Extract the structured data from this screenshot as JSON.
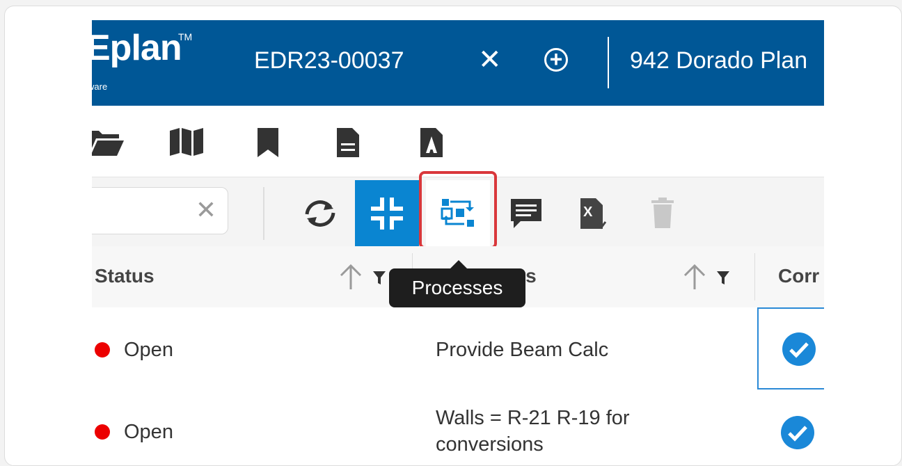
{
  "header": {
    "logo_text": "Eplan",
    "logo_tm": "TM",
    "logo_subtitle": "ware",
    "doc_tab": "EDR23-00037",
    "close_glyph": "✕",
    "add_glyph": "+",
    "address": "942 Dorado Plan"
  },
  "nav_icons": [
    "folder-icon",
    "map-icon",
    "bookmark-icon",
    "document-icon",
    "pdf-icon"
  ],
  "toolbar": {
    "search_placeholder": "",
    "clear_glyph": "✕",
    "buttons": [
      "sync-icon",
      "collapse-icon",
      "processes-icon",
      "comment-icon",
      "excel-export-icon",
      "trash-icon"
    ],
    "active_button": "collapse-icon",
    "hovered_button": "processes-icon"
  },
  "tooltip": {
    "text": "Processes"
  },
  "grid": {
    "columns": [
      {
        "title": "Status"
      },
      {
        "title": "Comments"
      },
      {
        "title": "Corr"
      }
    ],
    "rows": [
      {
        "status": "Open",
        "comment": "Provide Beam Calc",
        "checked": true
      },
      {
        "status": "Open",
        "comment": "Walls = R-21 R-19 for conversions",
        "checked": true
      }
    ]
  },
  "colors": {
    "header_bg": "#005796",
    "accent": "#0a85d1",
    "status_open": "#ec0000",
    "highlight": "#d9373b",
    "check": "#1a88d8"
  }
}
